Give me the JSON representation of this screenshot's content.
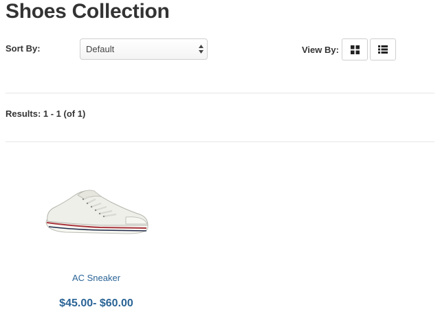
{
  "page": {
    "title": "Shoes Collection"
  },
  "sort": {
    "label": "Sort By:",
    "selected": "Default"
  },
  "view": {
    "label": "View By:",
    "grid_icon": "grid-view-icon",
    "list_icon": "list-view-icon"
  },
  "results": {
    "text": "Results: 1 - 1 (of 1)"
  },
  "products": [
    {
      "name": "AC Sneaker",
      "price": "$45.00- $60.00",
      "image_icon": "sneaker-image"
    }
  ],
  "colors": {
    "link": "#2a6496",
    "text": "#333333",
    "border": "#cfcfcf",
    "divider": "#e6e6e6"
  }
}
